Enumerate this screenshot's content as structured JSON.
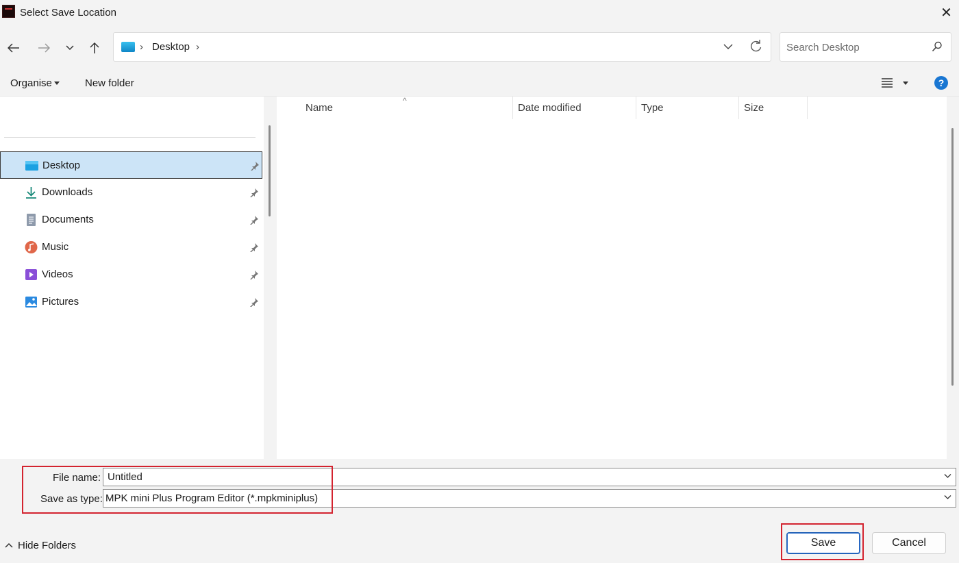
{
  "window": {
    "title": "Select Save Location",
    "close_glyph": "✕"
  },
  "address": {
    "crumb": "Desktop",
    "search_placeholder": "Search Desktop"
  },
  "commands": {
    "organise": "Organise",
    "new_folder": "New folder",
    "help": "?"
  },
  "navigation": {
    "items": [
      {
        "label": "Desktop",
        "icon": "desktop-icon",
        "pinned": true,
        "selected": true
      },
      {
        "label": "Downloads",
        "icon": "downloads-icon",
        "pinned": true
      },
      {
        "label": "Documents",
        "icon": "documents-icon",
        "pinned": true
      },
      {
        "label": "Music",
        "icon": "music-icon",
        "pinned": true
      },
      {
        "label": "Videos",
        "icon": "videos-icon",
        "pinned": true
      },
      {
        "label": "Pictures",
        "icon": "pictures-icon",
        "pinned": true
      }
    ]
  },
  "file_list": {
    "columns": [
      "Name",
      "Date modified",
      "Type",
      "Size"
    ],
    "rows": []
  },
  "save_form": {
    "file_name_label": "File name:",
    "file_name_value": "Untitled",
    "type_label": "Save as type:",
    "type_value": "MPK mini Plus Program Editor (*.mpkminiplus)"
  },
  "footer": {
    "hide_folders": "Hide Folders",
    "save": "Save",
    "cancel": "Cancel"
  },
  "colors": {
    "selection": "#cce4f7",
    "highlight": "#d3232f",
    "accent": "#1976d2"
  }
}
